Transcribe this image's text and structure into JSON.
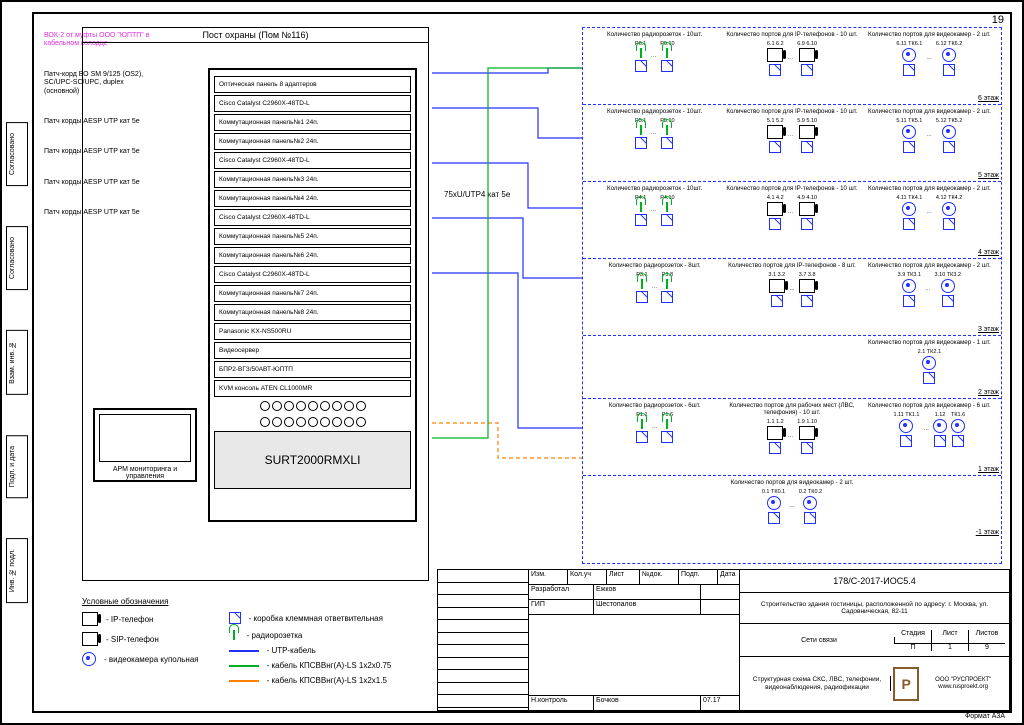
{
  "page_number": "19",
  "side_tabs": [
    "Согласовано",
    "Согласовано",
    "Взам. инв. №",
    "Подп. и дата",
    "Инв. № подл."
  ],
  "rack": {
    "room_title": "Пост охраны (Пом №116)",
    "incoming_note": "ВОК-2\nот муфты ООО \"ЮПТП\" в\nкабельном колодце",
    "patch_note_1": "Патч-корд ВО SM 9/125 (OS2),\nSC/UPC-SC/UPC, duplex\n(основной)",
    "patch_aesp": "Патч корды AESP\nUTP кат 5e",
    "devices": [
      "Оптическая панель 8 адаптеров",
      "Cisco Catalyst C2960X-48TD-L",
      "Коммутационная панель№1 24п.",
      "Коммутационная панель№2 24п.",
      "Cisco Catalyst C2960X-48TD-L",
      "Коммутационная панель№3 24п.",
      "Коммутационная панель№4 24п.",
      "Cisco Catalyst C2960X-48TD-L",
      "Коммутационная панель№5 24п.",
      "Коммутационная панель№6 24п.",
      "Cisco Catalyst C2960X-48TD-L",
      "Коммутационная панель№7 24п.",
      "Коммутационная панель№8 24п.",
      "Panasonic KX-NS500RU",
      "Видеосервер",
      "БПР2-ВГЗ/50АВТ-ЮПТП",
      "KVM консоль ATEN CL1000MR"
    ],
    "ups_label": "SURT2000RMXLI",
    "monitor_label": "АРМ мониторинга\nи управления"
  },
  "cable_run": "75xU/UTP4 кат 5e",
  "floors": [
    {
      "label": "6 этаж",
      "blocks": [
        {
          "title": "Количество\nрадиорозеток - 10шт.",
          "type": "radio",
          "items": [
            "P6.1",
            "P6.10"
          ]
        },
        {
          "title": "Количество портов для\nIP-телефонов - 10 шт.",
          "type": "ip",
          "items": [
            "6.1\n6.2",
            "6.9\n6.10"
          ]
        },
        {
          "title": "Количество портов для\nвидеокамер - 2 шт.",
          "type": "cam",
          "items": [
            "6.11 ТК6.1",
            "6.12 ТК6.2"
          ]
        }
      ]
    },
    {
      "label": "5 этаж",
      "blocks": [
        {
          "title": "Количество\nрадиорозеток - 10шт.",
          "type": "radio",
          "items": [
            "P5.1",
            "P5.10"
          ]
        },
        {
          "title": "Количество портов для\nIP-телефонов - 10 шт.",
          "type": "ip",
          "items": [
            "5.1\n5.2",
            "5.9\n5.10"
          ]
        },
        {
          "title": "Количество портов для\nвидеокамер - 2 шт.",
          "type": "cam",
          "items": [
            "5.11 ТК5.1",
            "5.12 ТК5.2"
          ]
        }
      ]
    },
    {
      "label": "4 этаж",
      "blocks": [
        {
          "title": "Количество\nрадиорозеток - 10шт.",
          "type": "radio",
          "items": [
            "P4.1",
            "P4.10"
          ]
        },
        {
          "title": "Количество портов для\nIP-телефонов - 10 шт.",
          "type": "ip",
          "items": [
            "4.1\n4.2",
            "4.9\n4.10"
          ]
        },
        {
          "title": "Количество портов для\nвидеокамер - 2 шт.",
          "type": "cam",
          "items": [
            "4.11 ТК4.1",
            "4.12 ТК4.2"
          ]
        }
      ]
    },
    {
      "label": "3 этаж",
      "blocks": [
        {
          "title": "Количество\nрадиорозеток - 8шт.",
          "type": "radio",
          "items": [
            "P3.1",
            "P3.8"
          ]
        },
        {
          "title": "Количество портов для\nIP-телефонов - 8 шт.",
          "type": "ip",
          "items": [
            "3.1\n3.2",
            "3.7\n3.8"
          ]
        },
        {
          "title": "Количество портов для\nвидеокамер - 2 шт.",
          "type": "cam",
          "items": [
            "3.9 ТК3.1",
            "3.10 ТК3.2"
          ]
        }
      ]
    },
    {
      "label": "2 этаж",
      "blocks": [
        {
          "title": "",
          "type": "none",
          "items": []
        },
        {
          "title": "",
          "type": "none",
          "items": []
        },
        {
          "title": "Количество портов для\nвидеокамер - 1 шт.",
          "type": "cam",
          "items": [
            "2.1 ТК2.1"
          ]
        }
      ]
    },
    {
      "label": "1 этаж",
      "blocks": [
        {
          "title": "Количество\nрадиорозеток - 6шт.",
          "type": "radio",
          "items": [
            "P1.1",
            "P1.6"
          ]
        },
        {
          "title": "Количество портов для рабочих\nмест (ЛВС, телефония) - 10 шт.",
          "type": "ip",
          "items": [
            "1.1\n1.2",
            "1.9\n1.10"
          ]
        },
        {
          "title": "Количество портов для\nвидеокамер - 6 шт.",
          "type": "cam",
          "items": [
            "1.11 ТК1.1",
            "1.12",
            "ТК1.6"
          ]
        }
      ]
    },
    {
      "label": "-1 этаж",
      "blocks": [
        {
          "title": "",
          "type": "none",
          "items": []
        },
        {
          "title": "Количество портов для\nвидеокамер - 2 шт.",
          "type": "cam",
          "items": [
            "0.1 ТК0.1",
            "0.2 ТК0.2"
          ]
        },
        {
          "title": "",
          "type": "none",
          "items": []
        }
      ]
    }
  ],
  "legend": {
    "title": "Условные обозначения",
    "left": [
      {
        "icon": "ipphone",
        "label": "- IP-телефон"
      },
      {
        "icon": "sipphone",
        "label": "- SIP-телефон"
      },
      {
        "icon": "cam",
        "label": "- видеокамера купольная"
      }
    ],
    "right": [
      {
        "icon": "sock",
        "label": "- коробка клеммная ответвительная"
      },
      {
        "icon": "antenna",
        "label": "- радиорозетка"
      },
      {
        "icon": "line-blue",
        "label": "- UTP-кабель"
      },
      {
        "icon": "line-green",
        "label": "- кабель КПСВВнг(А)-LS 1x2x0.75"
      },
      {
        "icon": "line-orange",
        "label": "- кабель КПСВВнг(А)-LS 1x2x1.5"
      }
    ]
  },
  "titleblock": {
    "doc_code": "178/С-2017-ИОС5.4",
    "project": "Строительство здания гостиницы, расположенной по адресу: г. Москва, ул. Садовническая, 82-11",
    "system": "Сети связи",
    "drawing": "Структурная схема СКС, ЛВС, телефонии,\nвидеонаблюдения, радиофикации",
    "company": "ООО \"РУСПРОЕКТ\"\nwww.rusproekt.org",
    "format": "Формат А3А",
    "cols": {
      "stage": "Стадия",
      "sheet": "Лист",
      "sheets": "Листов"
    },
    "vals": {
      "stage": "П",
      "sheet": "1",
      "sheets": "9"
    },
    "rows": [
      {
        "role": "Изм.",
        "n": "Кол.уч",
        "n2": "Лист",
        "n3": "№док.",
        "n4": "Подп.",
        "n5": "Дата"
      },
      {
        "role": "Разработал",
        "name": "Ежков"
      },
      {
        "role": "ГИП",
        "name": "Шестопалов"
      },
      {
        "role": "Н.контроль",
        "name": "Бочков",
        "date": "07.17"
      }
    ]
  }
}
